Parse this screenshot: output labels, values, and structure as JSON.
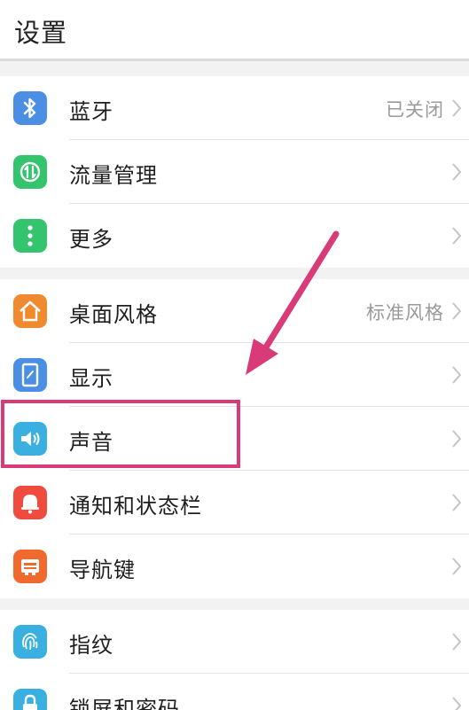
{
  "header": {
    "title": "设置"
  },
  "groups": [
    [
      {
        "label": "蓝牙",
        "value": "已关闭",
        "icon": "bluetooth-icon",
        "color": "#4a8fe3"
      },
      {
        "label": "流量管理",
        "value": "",
        "icon": "data-usage-icon",
        "color": "#35c46e"
      },
      {
        "label": "更多",
        "value": "",
        "icon": "more-vertical-icon",
        "color": "#35c46e"
      }
    ],
    [
      {
        "label": "桌面风格",
        "value": "标准风格",
        "icon": "home-icon",
        "color": "#f08a2e"
      },
      {
        "label": "显示",
        "value": "",
        "icon": "display-icon",
        "color": "#4a8fe3"
      },
      {
        "label": "声音",
        "value": "",
        "icon": "speaker-icon",
        "color": "#3ab0e0"
      },
      {
        "label": "通知和状态栏",
        "value": "",
        "icon": "notification-bell-icon",
        "color": "#ef4b3e"
      },
      {
        "label": "导航键",
        "value": "",
        "icon": "navigation-key-icon",
        "color": "#f06a2e"
      }
    ],
    [
      {
        "label": "指纹",
        "value": "",
        "icon": "fingerprint-icon",
        "color": "#3ab0e0"
      },
      {
        "label": "锁屏和密码",
        "value": "",
        "icon": "lock-icon",
        "color": "#3ab0e0"
      }
    ]
  ],
  "annotation": {
    "color": "#d93b78",
    "target": "声音"
  }
}
